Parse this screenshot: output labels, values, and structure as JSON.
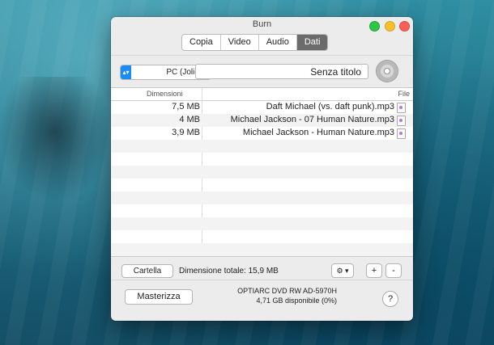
{
  "window": {
    "title": "Burn"
  },
  "tabs": [
    {
      "label": "Dati",
      "active": true
    },
    {
      "label": "Audio",
      "active": false
    },
    {
      "label": "Video",
      "active": false
    },
    {
      "label": "Copia",
      "active": false
    }
  ],
  "toolbar": {
    "format_select": "PC (Joliet)",
    "disc_title": "Senza titolo"
  },
  "table": {
    "columns": {
      "size": "Dimensioni",
      "file": "File"
    },
    "rows": [
      {
        "name": "Daft Michael (vs. daft punk).mp3",
        "size": "7,5 MB"
      },
      {
        "name": "Michael Jackson - 07 Human Nature.mp3",
        "size": "4 MB"
      },
      {
        "name": "Michael Jackson - Human Nature.mp3",
        "size": "3,9 MB"
      }
    ]
  },
  "bottom": {
    "folder_button": "Cartella",
    "total_size": "Dimensione totale: 15,9 MB",
    "gear_label": "⚙ ▾",
    "plus_label": "+",
    "minus_label": "-"
  },
  "burn": {
    "burn_button": "Masterizza",
    "drive_name": "OPTIARC DVD RW AD-5970H",
    "drive_space": "4,71 GB disponibile (0%)",
    "help_label": "?"
  },
  "colors": {
    "accent": "#1a8cf5",
    "active_tab": "#6b6b6b"
  }
}
